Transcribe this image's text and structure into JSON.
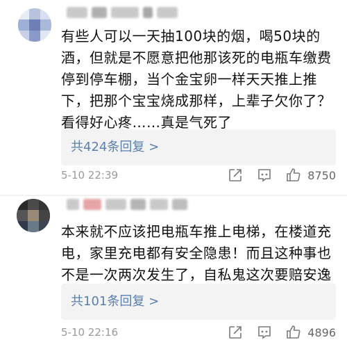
{
  "comments": [
    {
      "text": "有些人可以一天抽100块的烟，喝50块的酒，但就是不愿意把他那该死的电瓶车缴费停到停车棚，当个金宝卵一样天天推上推下，把那个宝宝烧成那样，上辈子欠你了？看得好心疼……真是气死了",
      "replies_label": "共424条回复 >",
      "time": "5-10 22:39",
      "likes": "8750",
      "icons": [
        "share-icon",
        "comment-icon",
        "like-icon"
      ]
    },
    {
      "text": "本来就不应该把电瓶车推上电梯，在楼道充电，家里充电都有安全隐患！而且这种事也不是一次两次发生了，自私鬼这次要赔安逸",
      "emoji": "angry-face-emoji",
      "replies_label": "共101条回复 >",
      "time": "5-10 22:16",
      "likes": "4896",
      "icons": [
        "share-icon",
        "comment-icon",
        "like-icon"
      ]
    }
  ]
}
